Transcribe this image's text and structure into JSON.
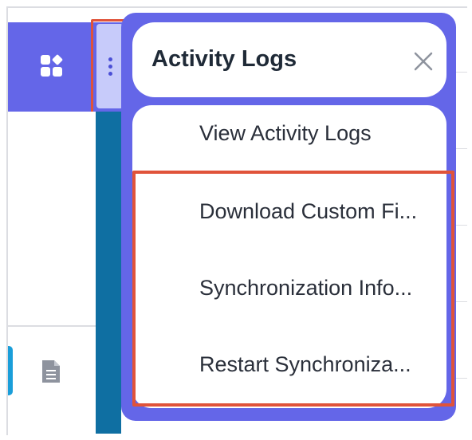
{
  "popover": {
    "title": "Activity Logs"
  },
  "menu": {
    "items": [
      {
        "label": "View Activity Logs"
      },
      {
        "label": "Download Custom Fi..."
      },
      {
        "label": "Synchronization Info..."
      },
      {
        "label": "Restart Synchroniza..."
      }
    ]
  },
  "colors": {
    "accent": "#6466e8",
    "highlight": "#e0533a",
    "strip": "#0f6fa2"
  },
  "icons": {
    "apps": "apps-icon",
    "menu": "kebab-menu-icon",
    "close": "close-icon",
    "document": "document-icon"
  }
}
